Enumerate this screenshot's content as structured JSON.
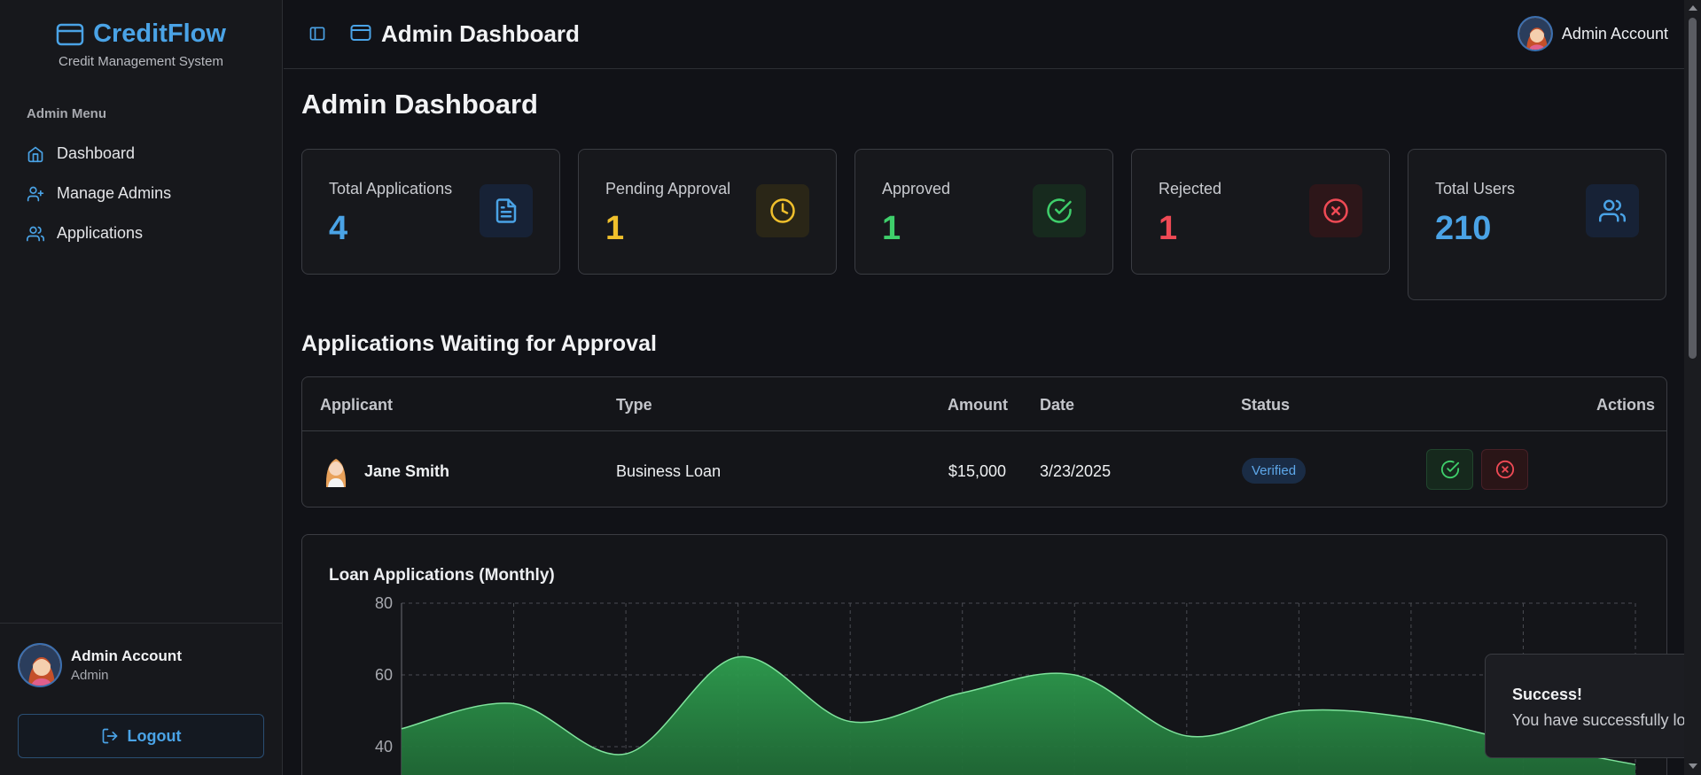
{
  "brand": {
    "name": "CreditFlow",
    "subtitle": "Credit Management System"
  },
  "sidebar": {
    "menu_title": "Admin Menu",
    "items": [
      {
        "label": "Dashboard",
        "icon": "home-icon"
      },
      {
        "label": "Manage Admins",
        "icon": "user-plus-icon"
      },
      {
        "label": "Applications",
        "icon": "users-icon"
      }
    ],
    "user": {
      "name": "Admin Account",
      "role": "Admin"
    },
    "logout_label": "Logout"
  },
  "header": {
    "title": "Admin Dashboard",
    "user_name": "Admin Account"
  },
  "main": {
    "title": "Admin Dashboard",
    "stats": [
      {
        "label": "Total Applications",
        "value": "4",
        "color": "#4aa3e6",
        "icon": "document-icon"
      },
      {
        "label": "Pending Approval",
        "value": "1",
        "color": "#f0c02c",
        "icon": "clock-icon"
      },
      {
        "label": "Approved",
        "value": "1",
        "color": "#3fcf6b",
        "icon": "check-circle-icon"
      },
      {
        "label": "Rejected",
        "value": "1",
        "color": "#ef4a55",
        "icon": "x-circle-icon"
      },
      {
        "label": "Total Users",
        "value": "210",
        "color": "#4aa3e6",
        "icon": "users-icon"
      }
    ],
    "section_title": "Applications Waiting for Approval",
    "table": {
      "columns": [
        "Applicant",
        "Type",
        "Amount",
        "Date",
        "Status",
        "Actions"
      ],
      "rows": [
        {
          "applicant": "Jane Smith",
          "type": "Business Loan",
          "amount": "$15,000",
          "date": "3/23/2025",
          "status": "Verified"
        }
      ]
    }
  },
  "chart_data": {
    "type": "area",
    "title": "Loan Applications (Monthly)",
    "y_ticks": [
      "80",
      "60",
      "40"
    ],
    "ylim_visible": [
      40,
      80
    ],
    "grid": true,
    "series": [
      {
        "values": [
          45,
          52,
          38,
          65,
          47,
          55,
          60,
          43,
          50,
          48,
          41,
          35
        ]
      }
    ],
    "color": "#2e9e4f"
  },
  "toast": {
    "title": "Success!",
    "message": "You have successfully logged in."
  }
}
